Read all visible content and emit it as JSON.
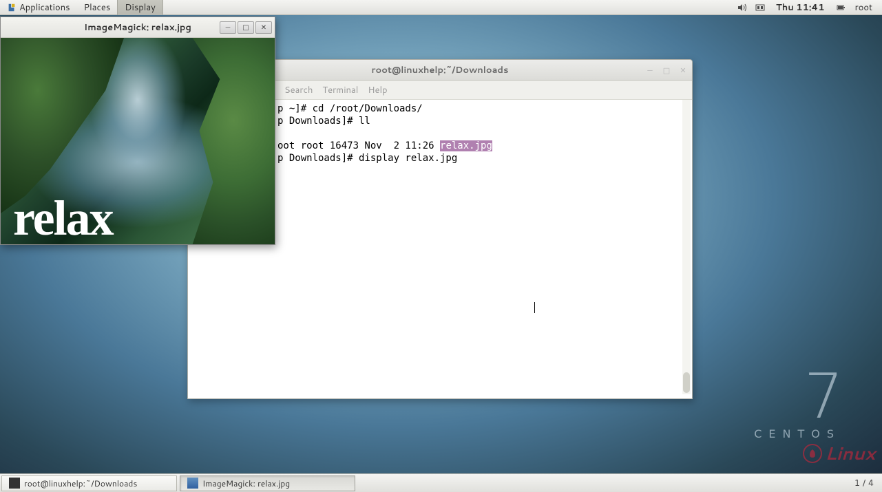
{
  "top_panel": {
    "applications": "Applications",
    "places": "Places",
    "active_app": "Display",
    "clock": "Thu 11:41",
    "user": "root"
  },
  "imagemagick": {
    "title": "ImageMagick: relax.jpg",
    "overlay_text": "relax"
  },
  "terminal": {
    "title": "root@linuxhelp:~/Downloads",
    "menu": {
      "search": "Search",
      "terminal": "Terminal",
      "help": "Help"
    },
    "lines": {
      "l1_prefix": "p ~]# cd /root/Downloads/",
      "l2": "p Downloads]# ll",
      "l3_prefix": "oot root 16473 Nov  2 11:26 ",
      "l3_hl": "relax.jpg",
      "l4": "p Downloads]# display relax.jpg"
    }
  },
  "desktop": {
    "centos_number": "7",
    "centos_name": "CENTOS",
    "linux_brand": "Linux"
  },
  "bottom_panel": {
    "task1": "root@linuxhelp:~/Downloads",
    "task2": "ImageMagick: relax.jpg",
    "workspace": "1 / 4"
  }
}
